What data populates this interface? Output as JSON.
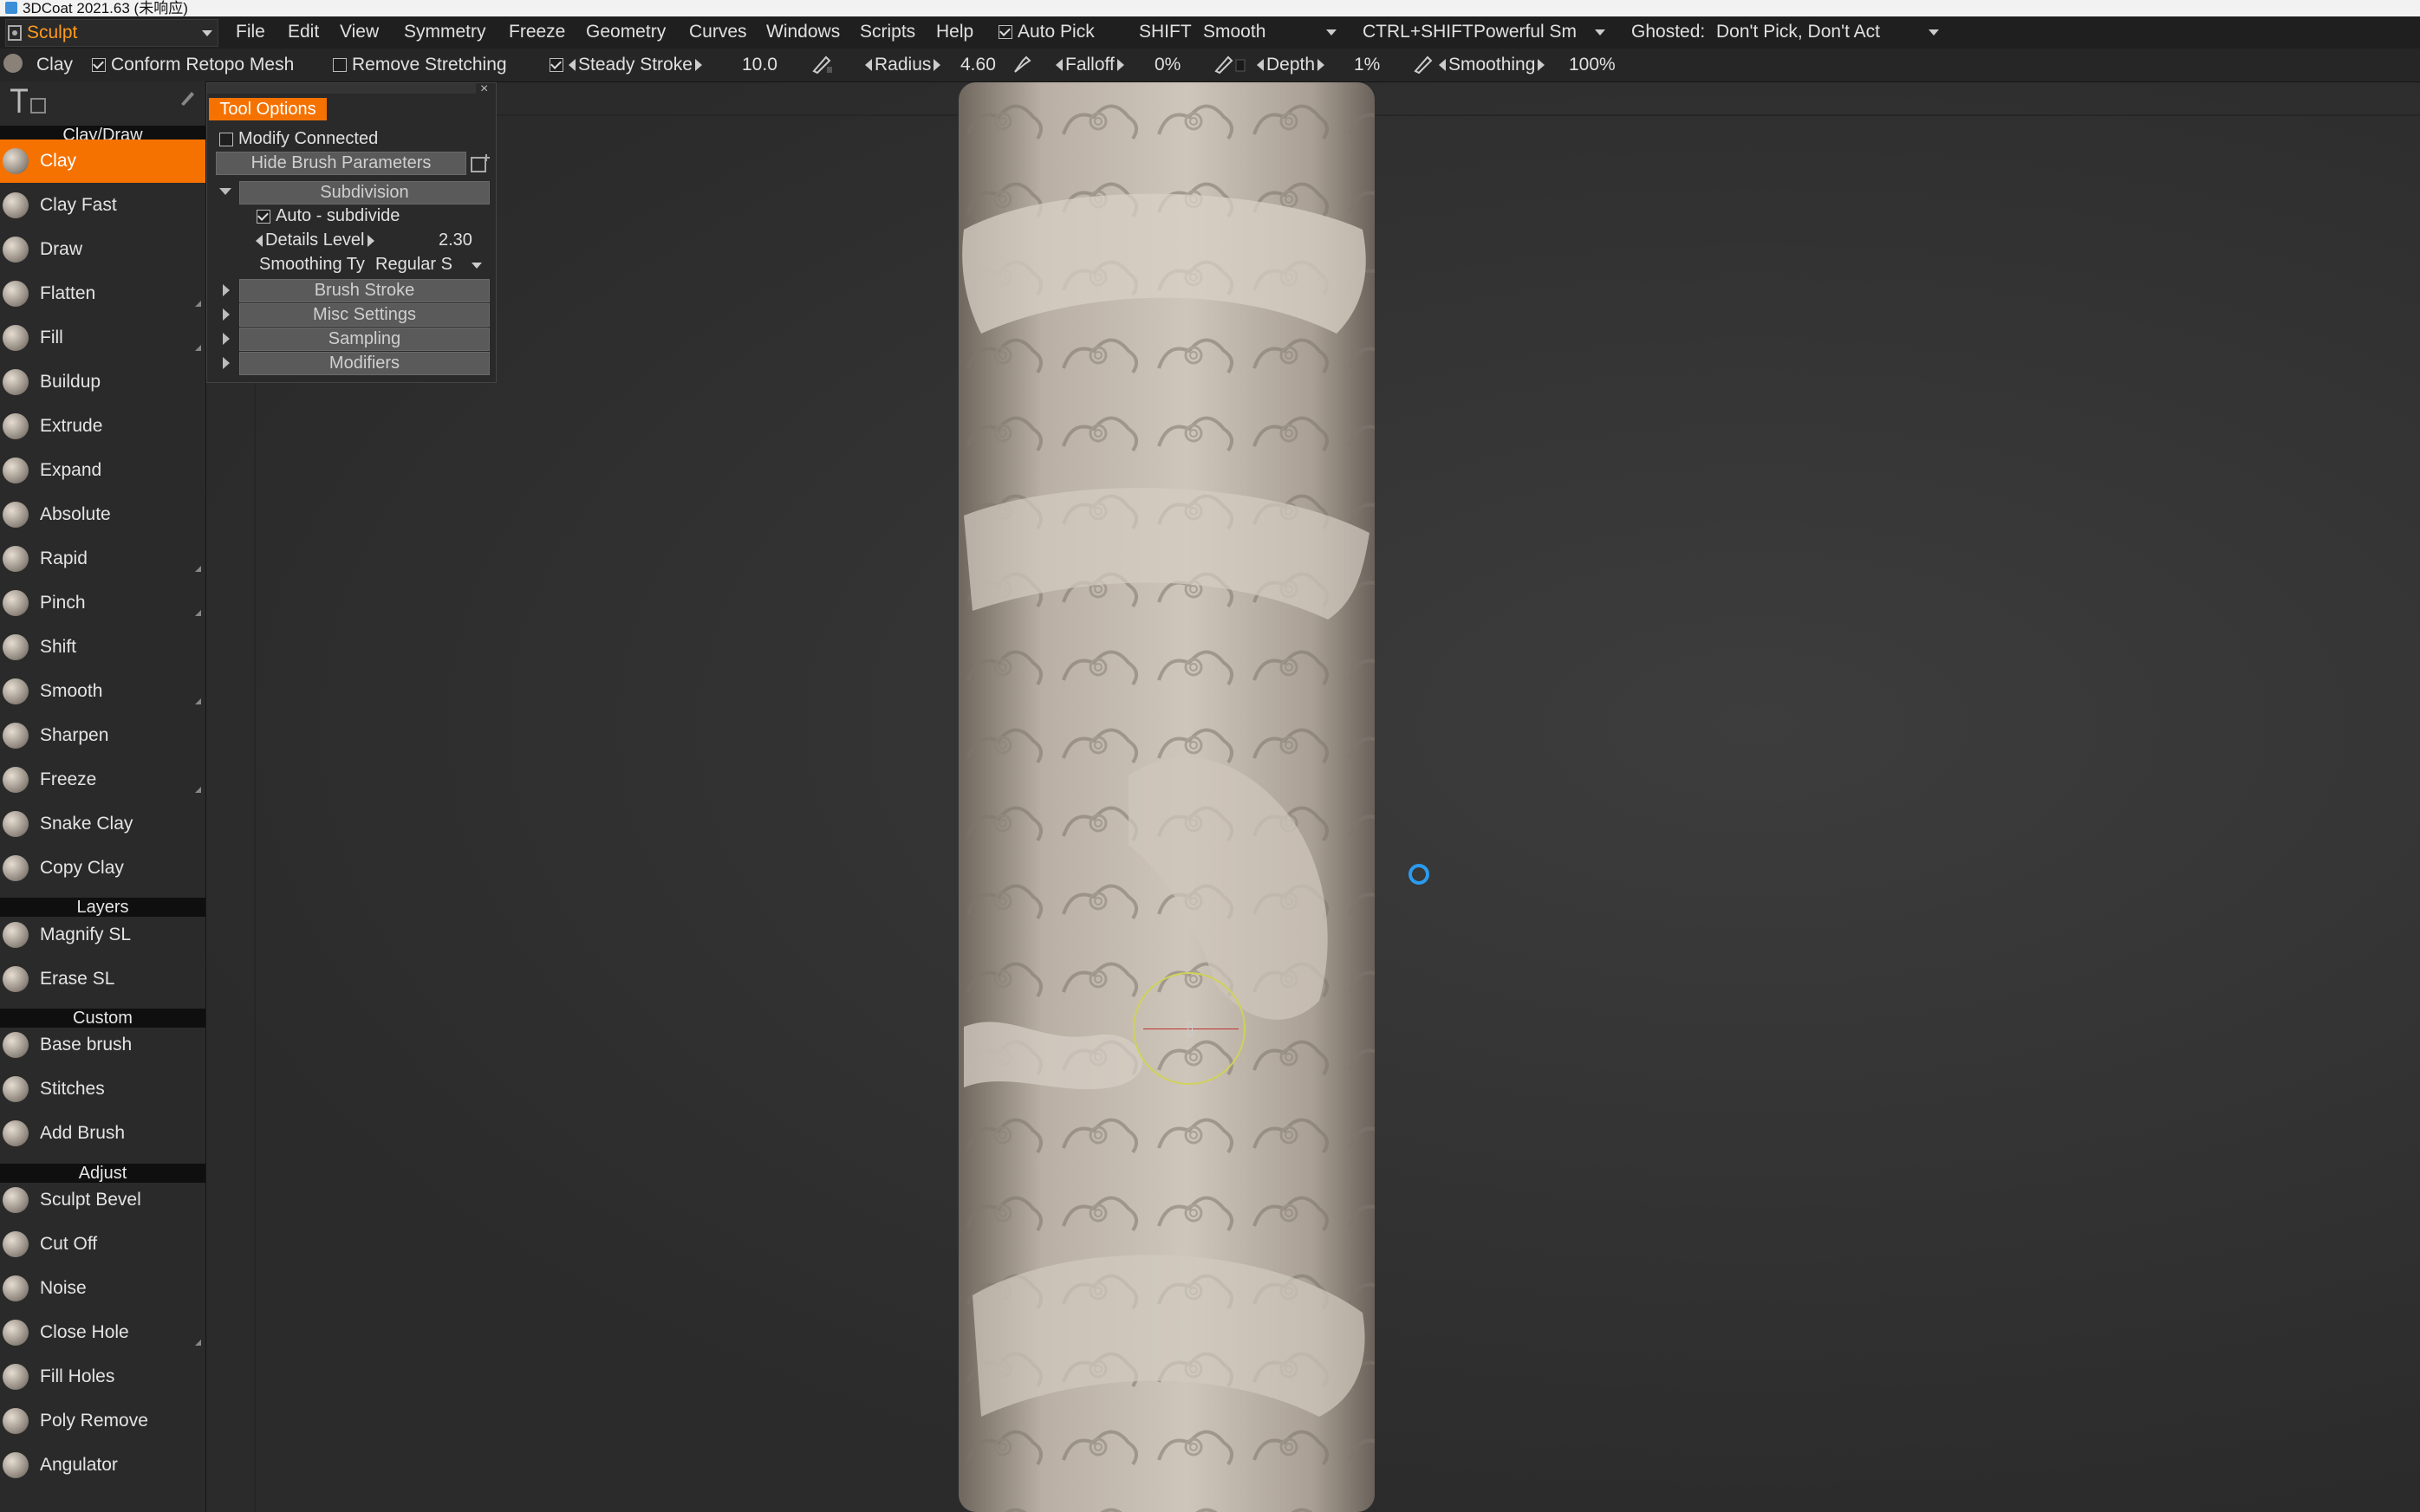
{
  "window": {
    "title": "3DCoat 2021.63 (未响应)"
  },
  "menubar": {
    "room": "Sculpt",
    "menus": [
      "File",
      "Edit",
      "View",
      "Symmetry",
      "Freeze",
      "Geometry",
      "Curves",
      "Windows",
      "Scripts",
      "Help"
    ],
    "auto_pick": "Auto Pick",
    "shift_label": "SHIFT",
    "shift_value": "Smooth",
    "ctrl_shift_label": "CTRL+SHIFT",
    "ctrl_shift_value": "Powerful Sm",
    "ghosted_label": "Ghosted:",
    "ghosted_value": "Don't Pick, Don't Act"
  },
  "toolbar": {
    "tool_name": "Clay",
    "conform": "Conform Retopo Mesh",
    "remove_stretching": "Remove Stretching",
    "steady_stroke": "Steady Stroke",
    "steady_value": "10.0",
    "radius_label": "Radius",
    "radius_value": "4.60",
    "falloff_label": "Falloff",
    "falloff_value": "0%",
    "depth_label": "Depth",
    "depth_value": "1%",
    "smoothing_label": "Smoothing",
    "smoothing_value": "100%"
  },
  "sidebar": {
    "sections": [
      "Clay/Draw",
      "Layers",
      "Custom",
      "Adjust"
    ],
    "claydraw": [
      "Clay",
      "Clay Fast",
      "Draw",
      "Flatten",
      "Fill",
      "Buildup",
      "Extrude",
      "Expand",
      "Absolute",
      "Rapid",
      "Pinch",
      "Shift",
      "Smooth",
      "Sharpen",
      "Freeze",
      "Snake Clay",
      "Copy Clay"
    ],
    "layers": [
      "Magnify SL",
      "Erase SL"
    ],
    "custom": [
      "Base brush",
      "Stitches",
      "Add Brush"
    ],
    "adjust": [
      "Sculpt Bevel",
      "Cut Off",
      "Noise",
      "Close Hole",
      "Fill Holes",
      "Poly Remove",
      "Angulator"
    ]
  },
  "tool_options": {
    "tab": "Tool Options",
    "modify_connected": "Modify Connected",
    "hide_brush_params": "Hide Brush Parameters",
    "subdivision": "Subdivision",
    "auto_subdivide": "Auto - subdivide",
    "details_level_label": "Details Level",
    "details_level_value": "2.30",
    "smoothing_type_label": "Smoothing Ty",
    "smoothing_type_value": "Regular S",
    "brush_stroke": "Brush Stroke",
    "misc_settings": "Misc Settings",
    "sampling": "Sampling",
    "modifiers": "Modifiers"
  },
  "colors": {
    "accent": "#f57200",
    "room_text": "#ff9a1f",
    "cursor": "#2a9bf0",
    "brush_circle": "#cfd25a"
  }
}
